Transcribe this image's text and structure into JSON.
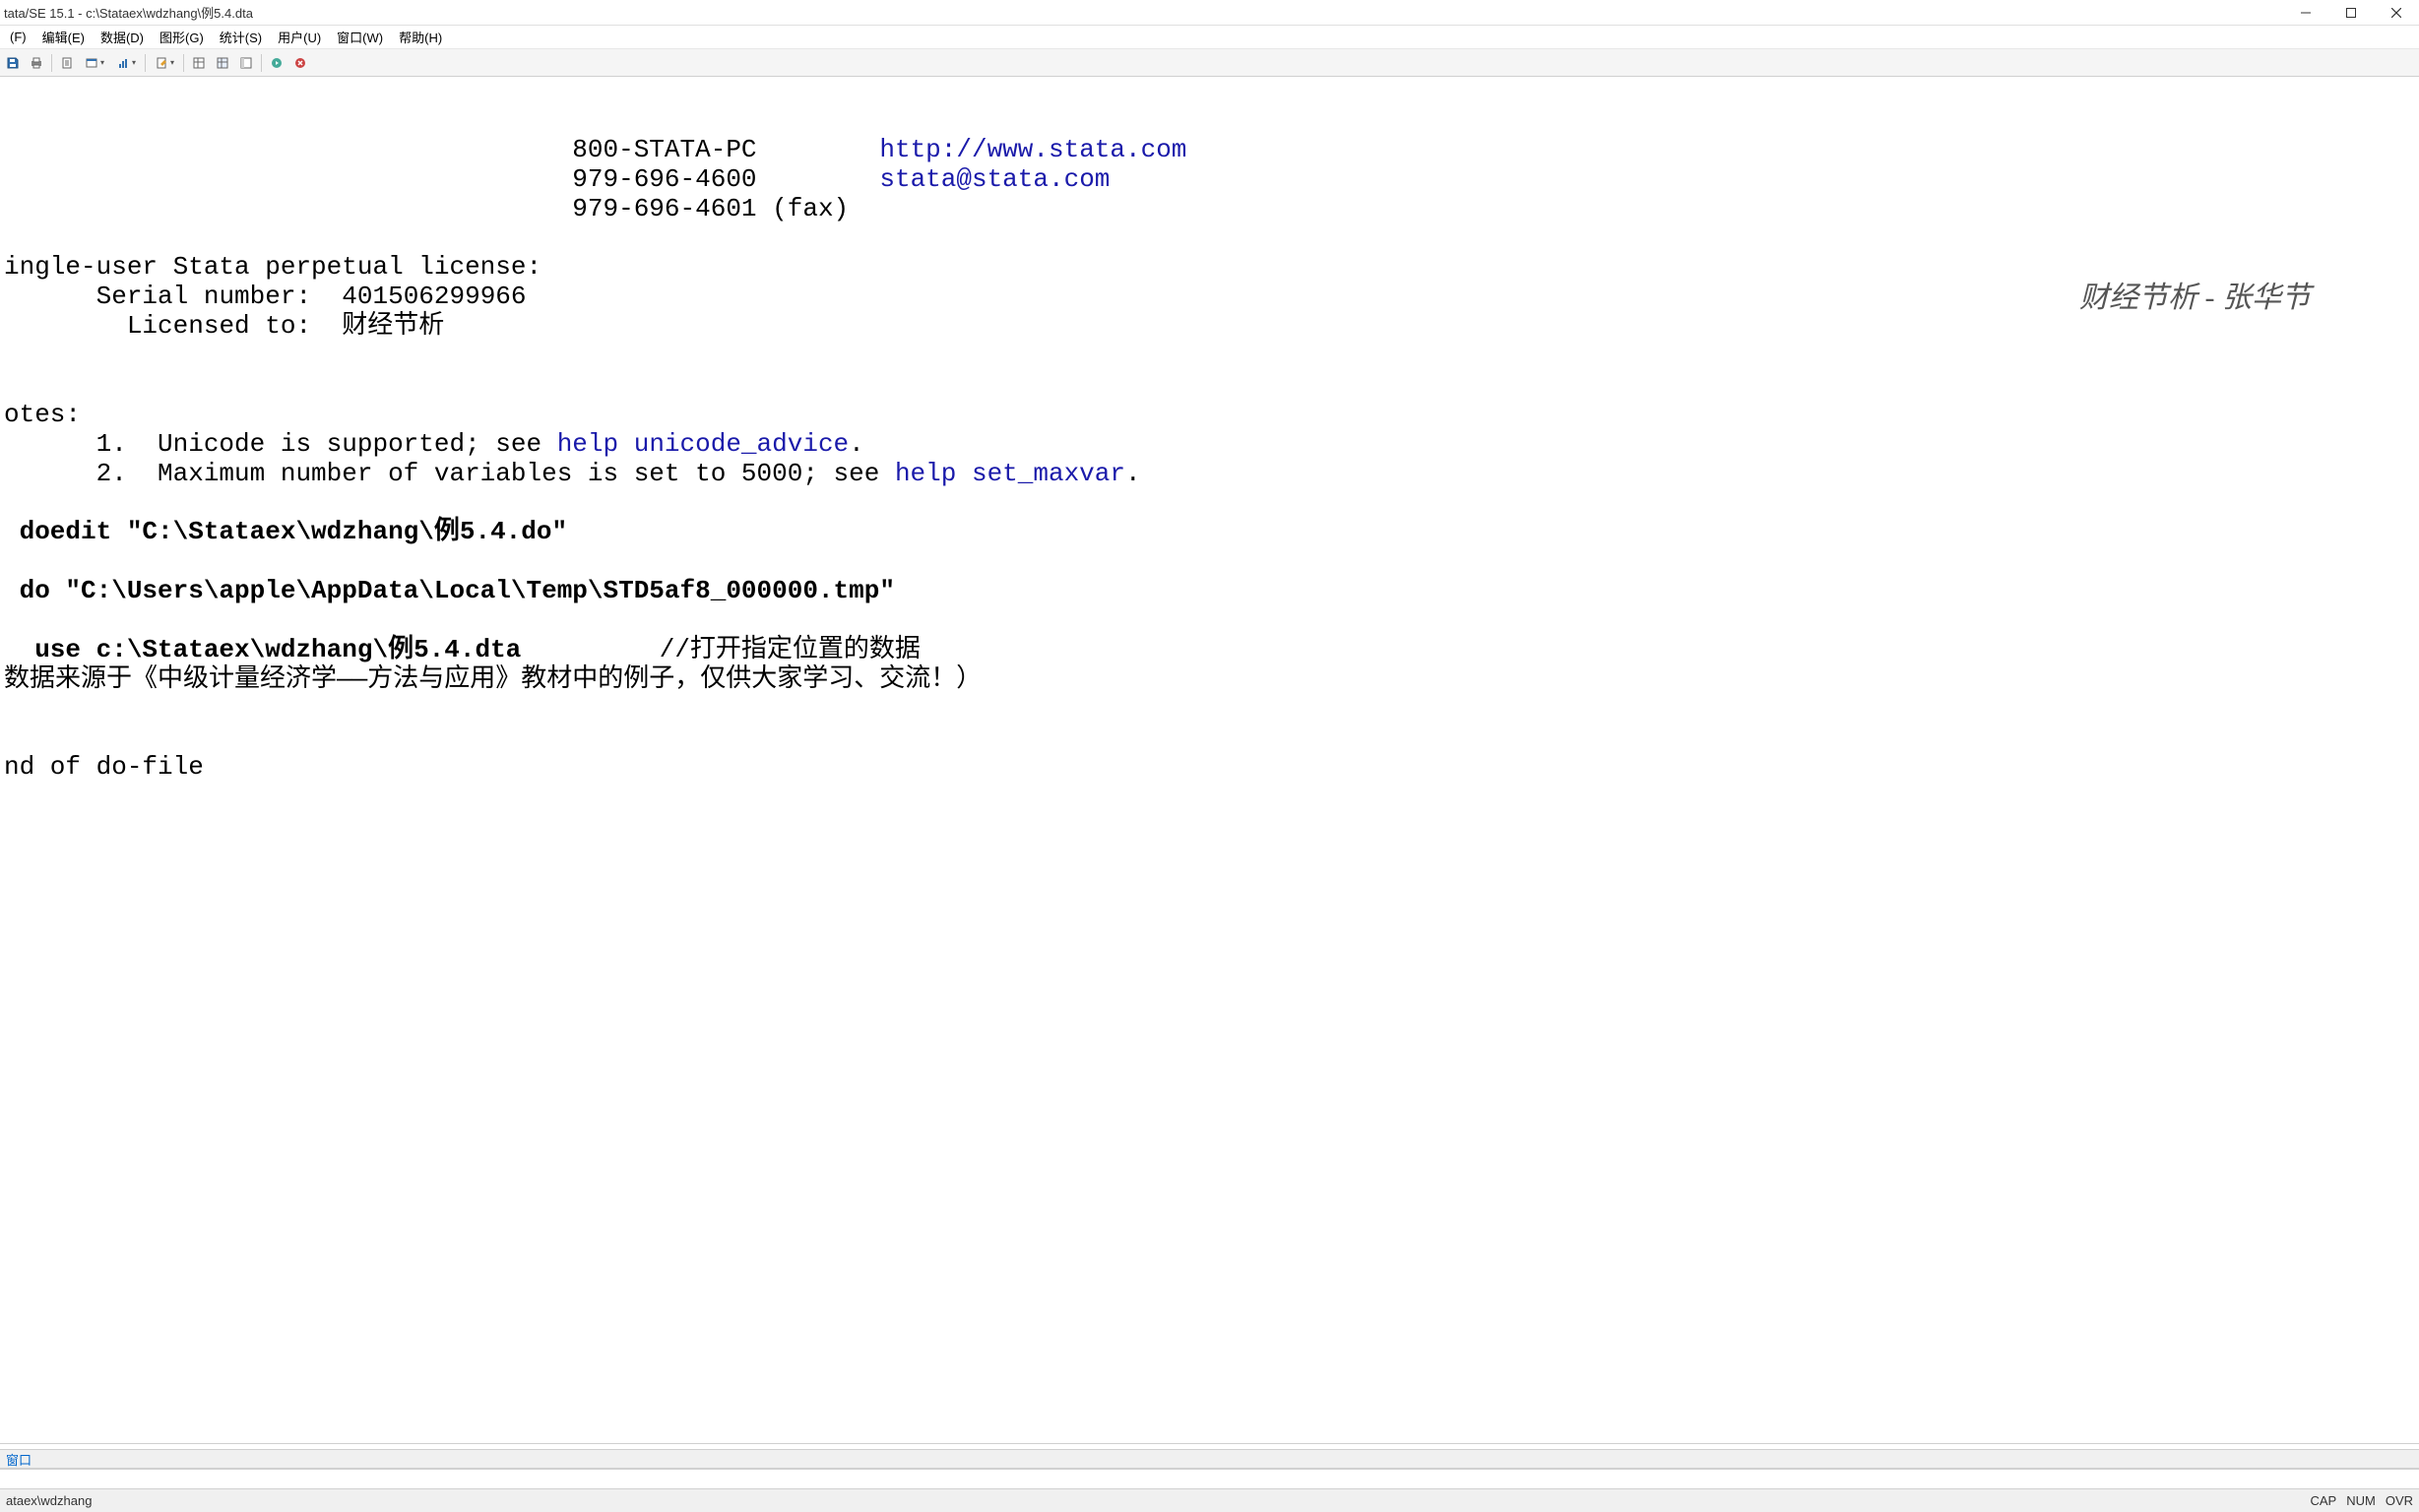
{
  "window": {
    "title": "tata/SE 15.1 - c:\\Stataex\\wdzhang\\例5.4.dta"
  },
  "menu": {
    "file": "(F)",
    "edit": "编辑(E)",
    "data": "数据(D)",
    "graphics": "图形(G)",
    "statistics": "统计(S)",
    "user": "用户(U)",
    "window": "窗口(W)",
    "help": "帮助(H)"
  },
  "results": {
    "phone1": "800-STATA-PC",
    "url": "http://www.stata.com",
    "phone2": "979-696-4600",
    "email": "stata@stata.com",
    "phone3": "979-696-4601 (fax)",
    "license_line": "ingle-user Stata perpetual license:",
    "serial_label": "Serial number:",
    "serial_value": "401506299966",
    "licensed_label": "Licensed to:",
    "licensed_value": "财经节析",
    "notes_label": "otes:",
    "note1_prefix": "      1.  Unicode is supported; see ",
    "note1_link": "help unicode_advice",
    "note2_prefix": "      2.  Maximum number of variables is set to 5000; see ",
    "note2_link": "help set_maxvar",
    "cmd1": " doedit \"C:\\Stataex\\wdzhang\\例5.4.do\"",
    "cmd2": " do \"C:\\Users\\apple\\AppData\\Local\\Temp\\STD5af8_000000.tmp\"",
    "cmd3_prefix": "  use c:\\Stataex\\wdzhang\\例5.4.dta         ",
    "cmd3_comment": "//打开指定位置的数据",
    "source_note": "数据来源于《中级计量经济学——方法与应用》教材中的例子，仅供大家学习、交流！）",
    "end_line": "nd of do-file",
    "watermark": "财经节析 - 张华节"
  },
  "command_panel": {
    "label": "窗口"
  },
  "status": {
    "path": "ataex\\wdzhang",
    "cap": "CAP",
    "num": "NUM",
    "ovr": "OVR"
  }
}
